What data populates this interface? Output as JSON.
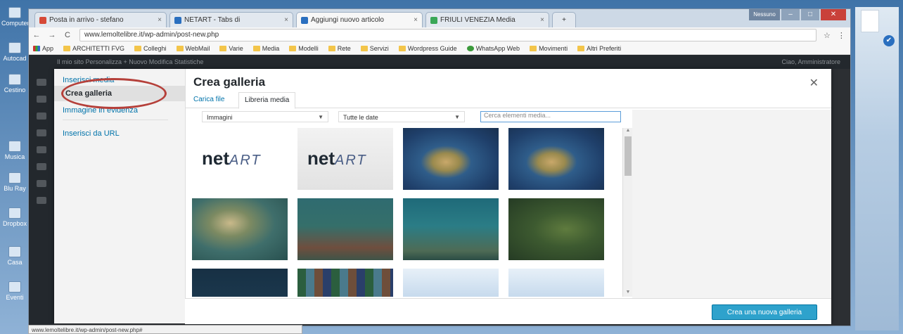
{
  "browser": {
    "tabs": [
      {
        "label": "Posta in arrivo - stefano",
        "icon": "gmail-icon",
        "color": "#d64937"
      },
      {
        "label": "NETART - Tabs di",
        "icon": "page-icon",
        "color": "#2a6fbf"
      },
      {
        "label": "Aggiungi nuovo articolo",
        "icon": "page-icon",
        "color": "#2a6fbf"
      },
      {
        "label": "FRIULI VENEZIA Media",
        "icon": "drive-icon",
        "color": "#3aa757"
      }
    ],
    "new_tab_symbol": "+",
    "window_user": "Nessuno",
    "window_controls": [
      "–",
      "□",
      "✕"
    ],
    "nav": {
      "back": "←",
      "forward": "→",
      "reload": "C"
    },
    "address": "www.lemoltelibre.it/wp-admin/post-new.php",
    "bookmarks": [
      {
        "label": "App",
        "icon": "apps"
      },
      {
        "label": "ARCHITETTI FVG",
        "icon": "folder"
      },
      {
        "label": "Colleghi",
        "icon": "folder"
      },
      {
        "label": "WebMail",
        "icon": "folder"
      },
      {
        "label": "Varie",
        "icon": "folder"
      },
      {
        "label": "Media",
        "icon": "folder"
      },
      {
        "label": "Modelli",
        "icon": "folder"
      },
      {
        "label": "Rete",
        "icon": "folder"
      },
      {
        "label": "Servizi",
        "icon": "folder"
      },
      {
        "label": "Wordpress Guide",
        "icon": "folder"
      },
      {
        "label": "WhatsApp Web",
        "icon": "green"
      },
      {
        "label": "Movimenti",
        "icon": "folder"
      },
      {
        "label": "Altri Preferiti",
        "icon": "folder"
      }
    ],
    "status_url": "www.lemoltelibre.it/wp-admin/post-new.php#"
  },
  "admin_bar": {
    "left": "Il mio sito     Personalizza     + Nuovo     Modifica     Statistiche",
    "right": "Ciao, Amministratore"
  },
  "desktop": {
    "left_icons": [
      "Computer",
      "Autocad",
      "Cestino",
      "Musica",
      "Blu Ray",
      "Dropbox",
      "Casa",
      "Eventi"
    ],
    "right_check": "✔"
  },
  "modal": {
    "sidebar": {
      "items": [
        "Inserisci media",
        "Crea galleria",
        "Immagine in evidenza"
      ],
      "active_index": 1,
      "extra_link": "Inserisci da URL"
    },
    "title": "Crea galleria",
    "close": "✕",
    "tabs": [
      "Carica file",
      "Libreria media"
    ],
    "active_tab": 1,
    "filters": {
      "type": "Immagini",
      "date": "Tutte le date",
      "arrow": "▼",
      "search_placeholder": "Cerca elementi media..."
    },
    "scroll": {
      "up": "▲",
      "down": "▼"
    },
    "thumbnails": [
      {
        "name": "netart-logo",
        "kind": "logo"
      },
      {
        "name": "netart-logo",
        "kind": "logo-gray"
      },
      {
        "name": "earth-map",
        "kind": "map"
      },
      {
        "name": "earth-map",
        "kind": "map"
      },
      {
        "name": "underwater-jellyfish",
        "kind": "sea1"
      },
      {
        "name": "underwater-reef",
        "kind": "sea2"
      },
      {
        "name": "underwater-fish",
        "kind": "sea3"
      },
      {
        "name": "underwater-rocks",
        "kind": "sea4"
      },
      {
        "name": "deep-sea",
        "kind": "deep"
      },
      {
        "name": "mosaic",
        "kind": "mosaic"
      },
      {
        "name": "sea-horizon",
        "kind": "sky"
      },
      {
        "name": "sea-horizon",
        "kind": "sky"
      }
    ],
    "logo_text": "net",
    "logo_suffix": "ART",
    "primary_button": "Crea una nuova galleria"
  },
  "colors": {
    "accent": "#2ea2cc",
    "highlight_ring": "#b5403a",
    "wp_dark": "#23282d"
  }
}
